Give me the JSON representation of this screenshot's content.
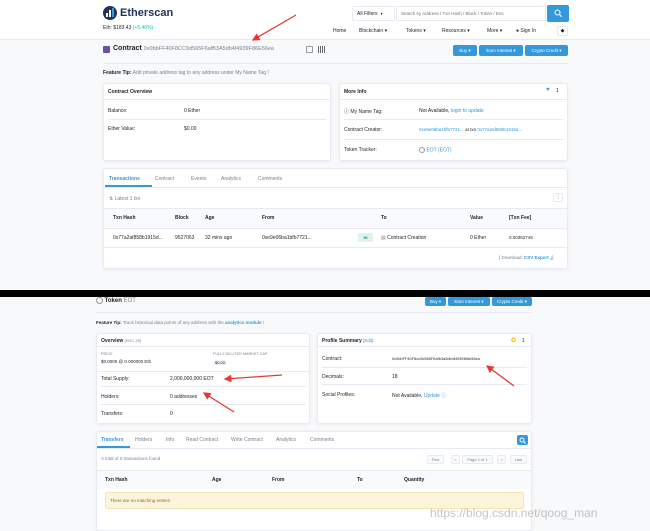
{
  "top": {
    "logo_text": "Etherscan",
    "eth_price": "Eth: $183.43",
    "eth_change": "(+5.46%)",
    "filter_label": "All Filters",
    "search_placeholder": "Search by Address / Txn Hash / Block / Token / Ens",
    "nav": [
      "Home",
      "Blockchain",
      "Tokens",
      "Resources",
      "More",
      "Sign In"
    ]
  },
  "contract_header": {
    "label": "Contract",
    "address": "0x0bbFF40F8CC9d565F6afB3A5db4f4939F86E56ea",
    "buttons": [
      "Buy",
      "Earn Interest",
      "Crypto Credit"
    ]
  },
  "feature_tip_1": {
    "bold": "Feature Tip:",
    "text": "Add private address tag to any address under My Name Tag !"
  },
  "overview": {
    "title": "Contract Overview",
    "rows": [
      {
        "label": "Balance:",
        "value": "0 Ether"
      },
      {
        "label": "Ether Value:",
        "value": "$0.00"
      }
    ]
  },
  "more_info": {
    "title": "More Info",
    "badge": "1",
    "name_tag_label": "My Name Tag:",
    "name_tag_value": "Not Available,",
    "name_tag_link": "login to update",
    "creator_label": "Contract Creator:",
    "creator_addr": "0xe9e06ba1bfb7721...",
    "creator_at": "at txn",
    "creator_txn": "0x77a2af858b1915d...",
    "tracker_label": "Token Tracker:",
    "tracker_value": "EOT (EOT)"
  },
  "tabs1": [
    "Transactions",
    "Contract",
    "Events",
    "Analytics",
    "Comments"
  ],
  "latest_txns": "Latest 1 txn",
  "txn_table": {
    "headers": [
      "Txn Hash",
      "Block",
      "Age",
      "From",
      "To",
      "Value",
      "[Txn Fee]"
    ],
    "row": {
      "hash": "0x77a2af858b1915d...",
      "block": "9527063",
      "age": "32 mins ago",
      "from": "0xe9e06ba1bfb7721...",
      "direction": "IN",
      "to": "Contract Creation",
      "value": "0 Ether",
      "fee": "0.00362749"
    }
  },
  "download": {
    "prefix": "[ Download:",
    "link": "CSV Export",
    "suffix": "]"
  },
  "token_header": {
    "label": "Token",
    "symbol": "EOT",
    "buttons": [
      "Buy",
      "Earn Interest",
      "Crypto Credit"
    ]
  },
  "feature_tip_2": {
    "bold": "Feature Tip:",
    "text": "Track historical data points of any address with the",
    "link": "analytics module",
    "suffix": "!"
  },
  "token_overview": {
    "title": "Overview",
    "tag": "[ERC-20]",
    "price_label": "PRICE",
    "price_value": "$0.0000 @ 0.000000 Eth",
    "mcap_label": "FULLY DILUTED MARKET CAP",
    "mcap_value": "$0.00",
    "rows": [
      {
        "label": "Total Supply:",
        "value": "2,000,000,000 EOT"
      },
      {
        "label": "Holders:",
        "value": "0 addresses"
      },
      {
        "label": "Transfers:",
        "value": "0"
      }
    ]
  },
  "profile": {
    "title": "Profile Summary",
    "edit": "[Edit]",
    "badge": "1",
    "rows": [
      {
        "label": "Contract:",
        "value": "0x0bbFF40F8cc9d565F6afb3a5db4f4939f86e56ea"
      },
      {
        "label": "Decimals:",
        "value": "18"
      },
      {
        "label": "Social Profiles:",
        "value": "Not Available,",
        "link": "Update"
      }
    ]
  },
  "tabs2": [
    "Transfers",
    "Holders",
    "Info",
    "Read Contract",
    "Write Contract",
    "Analytics",
    "Comments"
  ],
  "transfers": {
    "count_text": "A total of 0 transactions found",
    "pager": [
      "First",
      "<",
      "Page 1 of 1",
      ">",
      "Last"
    ],
    "headers": [
      "Txn Hash",
      "Age",
      "From",
      "To",
      "Quantity"
    ],
    "empty": "There are no matching entries"
  },
  "watermark": "https://blog.csdn.net/qoog_man",
  "colors": {
    "accent": "#3498db",
    "arrow": "#e53935",
    "header_bg": "#f8fafd",
    "empty_bg": "#fcf4dd"
  }
}
